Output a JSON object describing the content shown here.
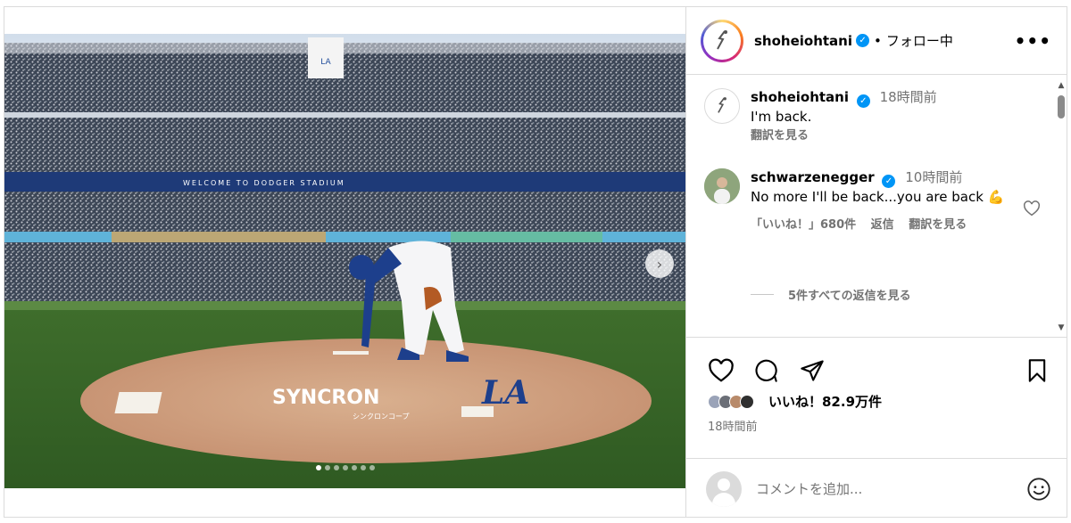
{
  "post": {
    "author": "shoheiohtani",
    "follow_status": "フォロー中",
    "separator": "•",
    "more_label": "•••",
    "image_alt": "Pitcher on the mound at Dodger Stadium",
    "stadium_banner": "WELCOME TO DODGER STADIUM",
    "mound_text": "SYNCRON",
    "mound_subtext": "シンクロンコープ",
    "mound_logo": "LA",
    "carousel": {
      "count": 7,
      "active_index": 0
    },
    "next_label": "›"
  },
  "caption": {
    "author": "shoheiohtani",
    "time": "18時間前",
    "text": "I'm back.",
    "see_translation": "翻訳を見る"
  },
  "comments": [
    {
      "author": "schwarzenegger",
      "time": "10時間前",
      "text": "No more I'll be back...you are back",
      "emoji": "💪",
      "likes": "「いいね！」680件",
      "reply": "返信",
      "see_translation": "翻訳を見る",
      "view_replies": "5件すべての返信を見る"
    }
  ],
  "stats": {
    "likes": "いいね！82.9万件",
    "time": "18時間前"
  },
  "comment_box": {
    "placeholder": "コメントを追加..."
  },
  "colors": {
    "verified": "#0095f6",
    "meta_gray": "#737373",
    "border": "#dbdbdb"
  },
  "icons": [
    "heart-icon",
    "comment-icon",
    "share-icon",
    "bookmark-icon",
    "emoji-icon",
    "more-icon",
    "verified-icon"
  ]
}
